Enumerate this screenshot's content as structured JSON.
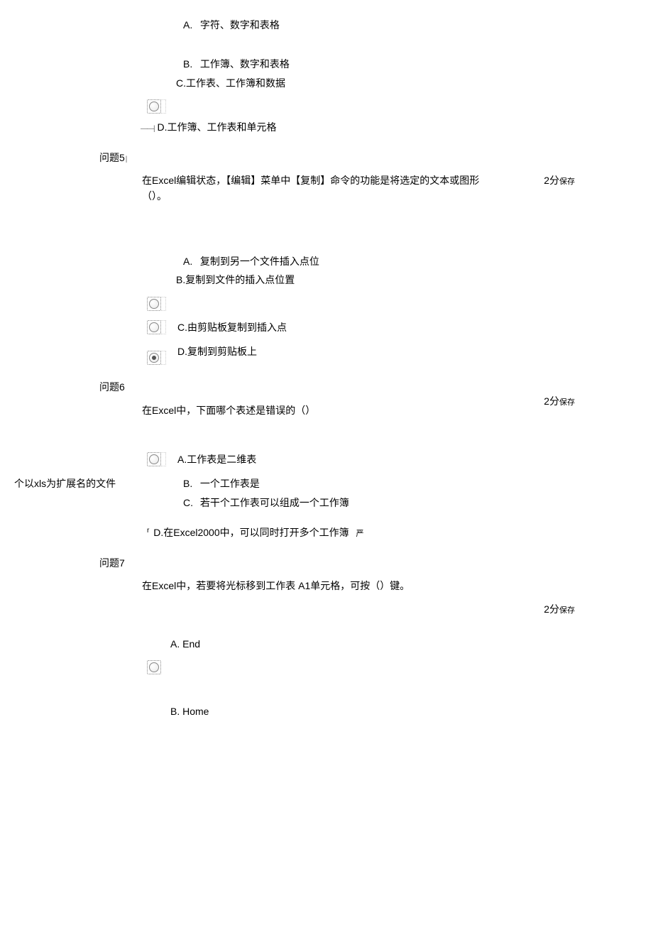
{
  "q4": {
    "optA": {
      "letter": "A.",
      "text": "字符、数字和表格"
    },
    "optB": {
      "letter": "B.",
      "text": "工作簿、数字和表格"
    },
    "optC": {
      "text": "C.工作表、工作簿和数据"
    },
    "optD": {
      "lead": "——|",
      "text": "D.工作簿、工作表和单元格"
    }
  },
  "q5": {
    "label": "问题5",
    "text": "在Excel编辑状态，【编辑】菜单中【复制】命令的功能是将选定的文本或图形（）。",
    "score": "2分",
    "save": "保存",
    "optA": {
      "letter": "A.",
      "text": "复制到另一个文件插入点位"
    },
    "optB": {
      "text": "B.复制到文件的插入点位置"
    },
    "optC": {
      "text": "C.由剪贴板复制到插入点"
    },
    "optD": {
      "text": "D.复制到剪贴板上"
    }
  },
  "q6": {
    "label": "问题6",
    "text": "在Excel中，下面哪个表述是错误的（）",
    "score": "2分",
    "save": "保存",
    "optA": {
      "text": "A.工作表是二维表"
    },
    "optB": {
      "letter": "B.",
      "text": "一个工作表是"
    },
    "sideB": "个以xls为扩展名的文件",
    "optC": {
      "letter": "C.",
      "text": "若干个工作表可以组成一个工作簿"
    },
    "optD": {
      "lead": "r",
      "text": "D.在Excel2000中，可以同时打开多个工作簿",
      "trail": "严"
    }
  },
  "q7": {
    "label": "问题7",
    "text": "在Excel中，若要将光标移到工作表 A1单元格，可按（）键。",
    "score": "2分",
    "save": "保存",
    "optA": {
      "text": "A. End"
    },
    "optB": {
      "text": "B. Home"
    }
  }
}
